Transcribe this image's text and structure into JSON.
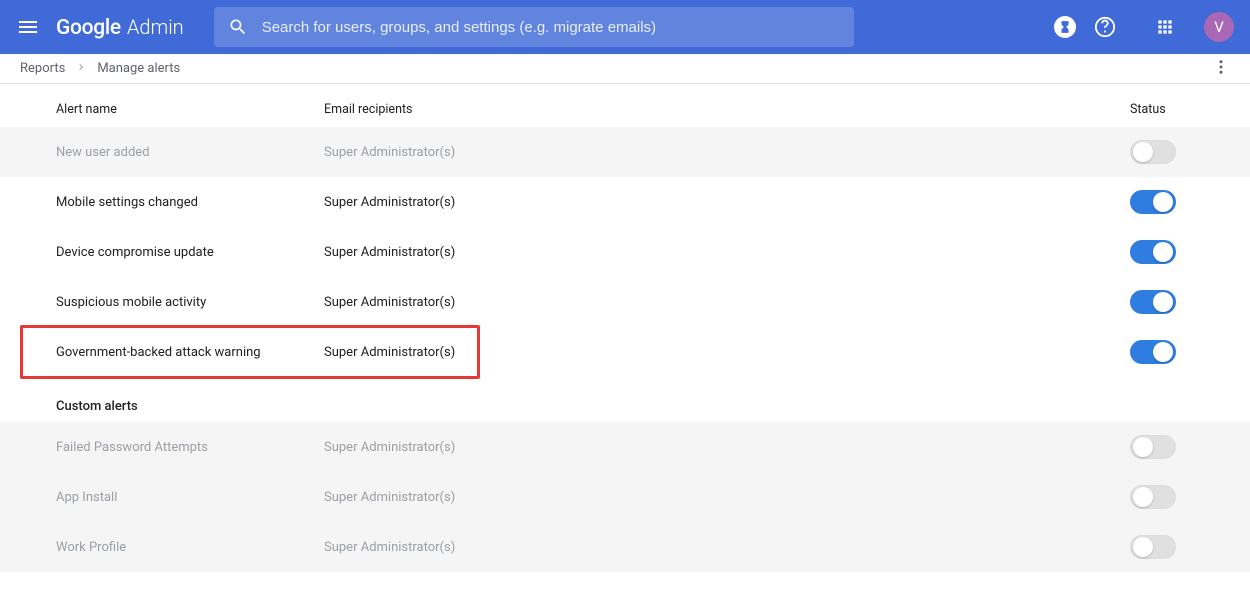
{
  "header": {
    "logo_google": "Google",
    "logo_admin": "Admin",
    "search_placeholder": "Search for users, groups, and settings (e.g. migrate emails)",
    "avatar_initial": "V"
  },
  "breadcrumb": {
    "root": "Reports",
    "current": "Manage alerts"
  },
  "columns": {
    "name": "Alert name",
    "recipients": "Email recipients",
    "status": "Status"
  },
  "alerts": [
    {
      "name": "New user added",
      "recipients": "Super Administrator(s)",
      "status": false,
      "highlighted": false
    },
    {
      "name": "Mobile settings changed",
      "recipients": "Super Administrator(s)",
      "status": true,
      "highlighted": false
    },
    {
      "name": "Device compromise update",
      "recipients": "Super Administrator(s)",
      "status": true,
      "highlighted": false
    },
    {
      "name": "Suspicious mobile activity",
      "recipients": "Super Administrator(s)",
      "status": true,
      "highlighted": false
    },
    {
      "name": "Government-backed attack warning",
      "recipients": "Super Administrator(s)",
      "status": true,
      "highlighted": true
    }
  ],
  "custom_section_title": "Custom alerts",
  "custom_alerts": [
    {
      "name": "Failed Password Attempts",
      "recipients": "Super Administrator(s)",
      "status": false
    },
    {
      "name": "App Install",
      "recipients": "Super Administrator(s)",
      "status": false
    },
    {
      "name": "Work Profile",
      "recipients": "Super Administrator(s)",
      "status": false
    }
  ]
}
